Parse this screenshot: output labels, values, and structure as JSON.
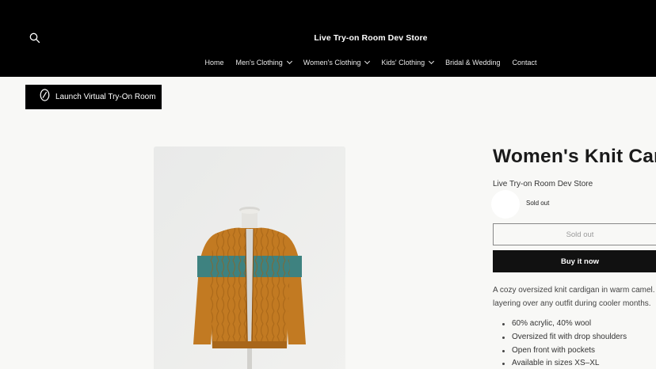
{
  "header": {
    "store_title": "Live Try-on Room Dev Store",
    "search_icon": "search-icon",
    "nav": [
      {
        "label": "Home",
        "has_dropdown": false
      },
      {
        "label": "Men's Clothing",
        "has_dropdown": true
      },
      {
        "label": "Women's Clothing",
        "has_dropdown": true
      },
      {
        "label": "Kids' Clothing",
        "has_dropdown": true
      },
      {
        "label": "Bridal & Wedding",
        "has_dropdown": false
      },
      {
        "label": "Contact",
        "has_dropdown": false
      }
    ]
  },
  "launch_button": {
    "label": "Launch Virtual Try-On Room",
    "icon": "hanger-oval-icon"
  },
  "product": {
    "title": "Women's Knit Car",
    "vendor": "Live Try-on Room Dev Store",
    "badge": "Sold out",
    "soldout_label": "Sold out",
    "buy_label": "Buy it now",
    "description_lines": [
      "A cozy oversized knit cardigan in warm camel.",
      "layering over any outfit during cooler months."
    ],
    "features": [
      "60% acrylic, 40% wool",
      "Oversized fit with drop shoulders",
      "Open front with pockets",
      "Available in sizes XS–XL"
    ]
  },
  "colors": {
    "header_bg": "#000000",
    "page_bg": "#f8f8f6",
    "buy_button_bg": "#111111",
    "cardigan_camel": "#c27a22",
    "cardigan_stripe_teal": "#3e8280"
  }
}
